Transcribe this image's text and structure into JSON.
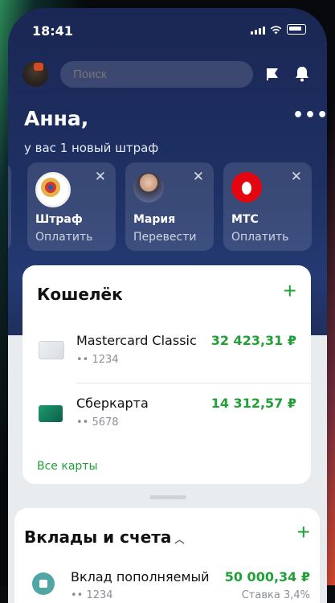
{
  "status": {
    "time": "18:41"
  },
  "search": {
    "placeholder": "Поиск"
  },
  "greeting": {
    "name": "Анна,",
    "subtitle": "у вас 1 новый штраф"
  },
  "stories": [
    {
      "title": "Штраф",
      "subtitle": "Оплатить"
    },
    {
      "title": "Мария",
      "subtitle": "Перевести"
    },
    {
      "title": "МТС",
      "subtitle": "Оплатить"
    }
  ],
  "wallet": {
    "title": "Кошелёк",
    "cards": [
      {
        "name": "Mastercard Classic",
        "number": "•• 1234",
        "amount": "32 423,31 ₽"
      },
      {
        "name": "Сберкарта",
        "number": "•• 5678",
        "amount": "14 312,57 ₽"
      }
    ],
    "all_cards_label": "Все карты"
  },
  "deposits": {
    "title": "Вклады и счета",
    "items": [
      {
        "name": "Вклад пополняемый",
        "number": "•• 1234",
        "amount": "50 000,34 ₽",
        "rate": "Ставка 3,4%"
      }
    ]
  },
  "colors": {
    "accent": "#21a038",
    "header_bg": "#1e3063"
  }
}
